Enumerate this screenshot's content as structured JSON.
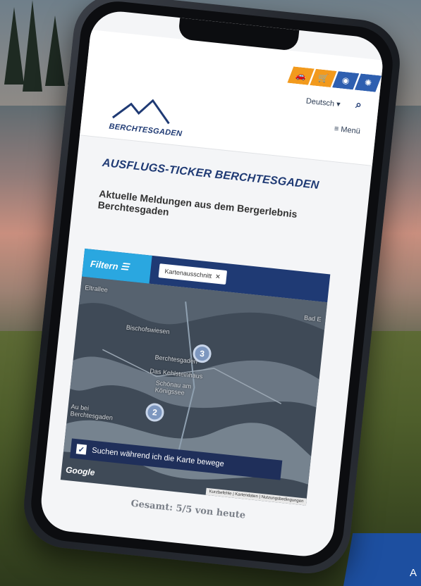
{
  "header": {
    "tab_icons": [
      "car-icon",
      "shopping-cart-icon",
      "location-pin-icon",
      "sun-icon"
    ],
    "language": "Deutsch",
    "menu_label": "Menü",
    "logo_text": "BERCHTESGADEN"
  },
  "content": {
    "ticker_title": "AUSFLUGS-TICKER BERCHTESGADEN",
    "subtitle": "Aktuelle Meldungen aus dem Bergerlebnis Berchtesgaden"
  },
  "filter": {
    "button_label": "Filtern",
    "chip_label": "Kartenausschnitt"
  },
  "map": {
    "clusters": [
      {
        "count": "3"
      },
      {
        "count": "2"
      }
    ],
    "labels": {
      "top_left": "Eltrallee",
      "top_right": "Bad E",
      "area1": "Bischofswiesen",
      "poi1": "Berchtesgaden",
      "poi2": "Das Kehlsteinhaus",
      "poi3": "Schönau am Königssee",
      "left": "Au bei Berchtesgaden"
    },
    "search_checkbox_label": "Suchen während ich die Karte bewege",
    "google_label": "Google",
    "attribution": "Kurzbefehle | Kartendaten | Nutzungsbedingungen"
  },
  "summary": {
    "total": "Gesamt: 5/5 von heute"
  },
  "corner_badge": "A",
  "colors": {
    "brand_blue": "#1f3a74",
    "accent_orange": "#f29a1d",
    "filter_cyan": "#2aa7e0"
  }
}
